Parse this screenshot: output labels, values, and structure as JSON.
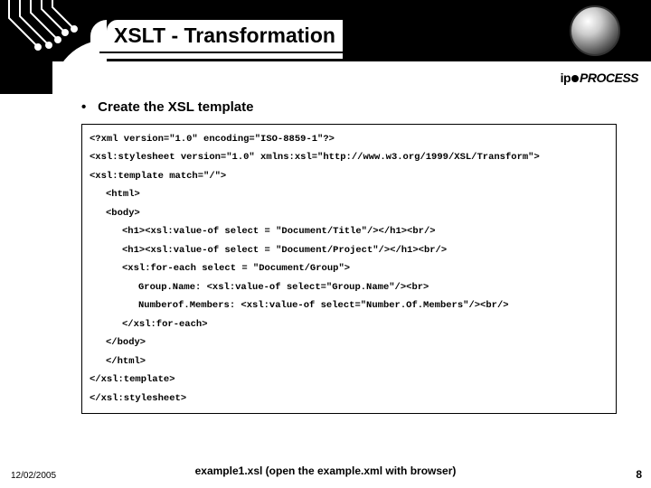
{
  "header": {
    "title": "XSLT - Transformation"
  },
  "brand": {
    "ip": "ip",
    "rest": "PROCESS"
  },
  "bullet": {
    "mark": "•",
    "text": "Create the XSL template"
  },
  "code": {
    "l1": "<?xml version=\"1.0\" encoding=\"ISO-8859-1\"?>",
    "l2": "<xsl:stylesheet version=\"1.0\" xmlns:xsl=\"http://www.w3.org/1999/XSL/Transform\">",
    "l3": "<xsl:template match=\"/\">",
    "l4": "<html>",
    "l5": "<body>",
    "l6": "<h1><xsl:value-of select = \"Document/Title\"/></h1><br/>",
    "l7": "<h1><xsl:value-of select = \"Document/Project\"/></h1><br/>",
    "l8": "<xsl:for-each select = \"Document/Group\">",
    "l9": "Group.Name: <xsl:value-of select=\"Group.Name\"/><br>",
    "l10": "Numberof.Members: <xsl:value-of select=\"Number.Of.Members\"/><br/>",
    "l11": "</xsl:for-each>",
    "l12": "</body>",
    "l13": "</html>",
    "l14": "</xsl:template>",
    "l15": "</xsl:stylesheet>"
  },
  "footer": {
    "caption": "example1.xsl (open the example.xml with browser)",
    "date": "12/02/2005",
    "page": "8"
  }
}
